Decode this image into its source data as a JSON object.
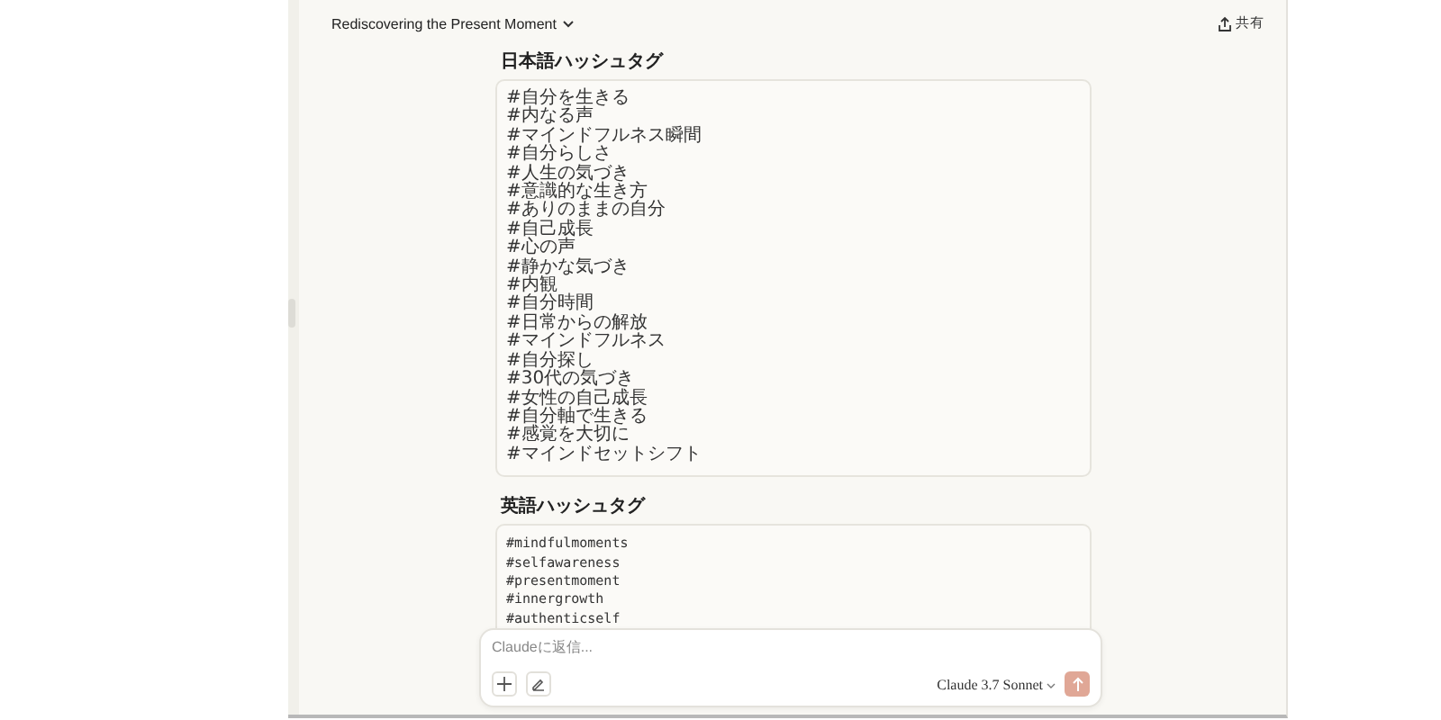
{
  "header": {
    "title": "Rediscovering the Present Moment",
    "share": "共有"
  },
  "sections": [
    {
      "heading": "日本語ハッシュタグ",
      "kind": "jp",
      "lines": [
        "#自分を生きる",
        "#内なる声",
        "#マインドフルネス瞬間",
        "#自分らしさ",
        "#人生の気づき",
        "#意識的な生き方",
        "#ありのままの自分",
        "#自己成長",
        "#心の声",
        "#静かな気づき",
        "#内観",
        "#自分時間",
        "#日常からの解放",
        "#マインドフルネス",
        "#自分探し",
        "#30代の気づき",
        "#女性の自己成長",
        "#自分軸で生きる",
        "#感覚を大切に",
        "#マインドセットシフト"
      ]
    },
    {
      "heading": "英語ハッシュタグ",
      "kind": "en",
      "lines": [
        "#mindfulmoments",
        "#selfawareness",
        "#presentmoment",
        "#innergrowth",
        "#authenticself"
      ]
    }
  ],
  "composer": {
    "placeholder": "Claudeに返信...",
    "model": "Claude 3.7 Sonnet"
  }
}
